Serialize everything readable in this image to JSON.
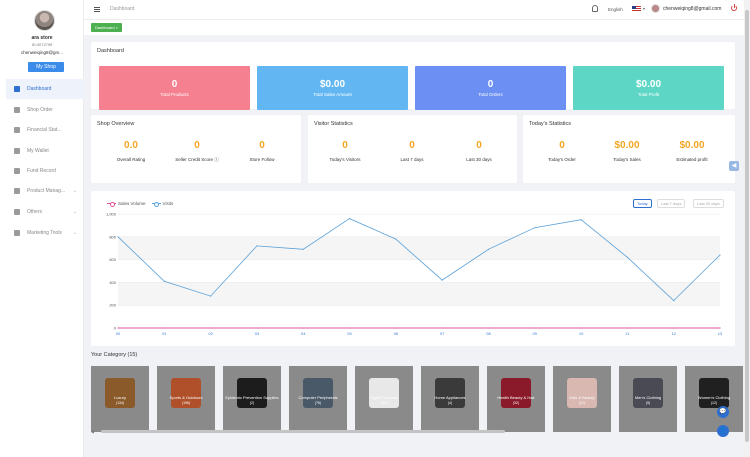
{
  "sidebar": {
    "store_name": "ara store",
    "store_id": "ID:4072795",
    "store_email": "chenweiqing8@gm...",
    "myshop_label": "My Shop",
    "items": [
      {
        "label": "Dashboard",
        "icon": "dashboard-icon",
        "active": true
      },
      {
        "label": "Shop Order",
        "icon": "order-icon",
        "chevron": false
      },
      {
        "label": "Financial Stat...",
        "icon": "finance-icon",
        "chevron": false
      },
      {
        "label": "My Wallet",
        "icon": "wallet-icon",
        "chevron": false
      },
      {
        "label": "Fund Record",
        "icon": "record-icon",
        "chevron": false
      },
      {
        "label": "Product Manag...",
        "icon": "product-icon",
        "chevron": true
      },
      {
        "label": "Others",
        "icon": "grid-icon",
        "chevron": true
      },
      {
        "label": "Marketing Tools",
        "icon": "chart-icon",
        "chevron": true
      }
    ]
  },
  "topbar": {
    "breadcrumb": "Dashboard",
    "language": "English",
    "caret": "▾",
    "user_email": "chenweiqing8@gmail.com"
  },
  "tag": {
    "label": "Dashboard ×"
  },
  "dashboard": {
    "title": "Dashboard",
    "stats": [
      {
        "value": "0",
        "label": "Total Products",
        "color": "#f5808f"
      },
      {
        "value": "$0.00",
        "label": "Total Sales Amount",
        "color": "#62b7f2"
      },
      {
        "value": "0",
        "label": "Total Orders",
        "color": "#6b8ff2"
      },
      {
        "value": "$0.00",
        "label": "Total Profit",
        "color": "#5ed6c6"
      }
    ]
  },
  "shop_overview": {
    "title": "Shop Overview",
    "metrics": [
      {
        "value": "0.0",
        "label": "Overall Rating"
      },
      {
        "value": "0",
        "label": "Seller Credit Score ⓘ"
      },
      {
        "value": "0",
        "label": "Store Follow"
      }
    ]
  },
  "visitor_statistics": {
    "title": "Visitor Statistics",
    "metrics": [
      {
        "value": "0",
        "label": "Today's Visitors"
      },
      {
        "value": "0",
        "label": "Last 7 days"
      },
      {
        "value": "0",
        "label": "Last 30 days"
      }
    ]
  },
  "todays_statistics": {
    "title": "Today's Statistics",
    "metrics": [
      {
        "value": "0",
        "label": "Today's Order"
      },
      {
        "value": "$0.00",
        "label": "Today's Sales"
      },
      {
        "value": "$0.00",
        "label": "Estimated profit"
      }
    ]
  },
  "chart_controls": {
    "legend": [
      {
        "name": "Sales Volume",
        "color": "#e0559a"
      },
      {
        "name": "Visits",
        "color": "#5aa0d8"
      }
    ],
    "ranges": [
      {
        "label": "Today",
        "active": true
      },
      {
        "label": "Last 7 days",
        "active": false
      },
      {
        "label": "Last 30 days",
        "active": false
      }
    ]
  },
  "chart_data": {
    "type": "line",
    "x": [
      "00",
      "01",
      "02",
      "03",
      "04",
      "05",
      "06",
      "07",
      "08",
      "09",
      "10",
      "11",
      "12",
      "13"
    ],
    "series": [
      {
        "name": "Sales Volume",
        "color": "#e0559a",
        "values": [
          0,
          0,
          0,
          0,
          0,
          0,
          0,
          0,
          0,
          0,
          0,
          0,
          0,
          0
        ]
      },
      {
        "name": "Visits",
        "color": "#5aa0d8",
        "values": [
          800,
          410,
          280,
          720,
          690,
          960,
          780,
          420,
          690,
          880,
          950,
          620,
          240,
          640
        ]
      }
    ],
    "ylim": [
      0,
      1000
    ],
    "yticks": [
      "0",
      "200",
      "400",
      "600",
      "800",
      "1,000"
    ],
    "grid": true
  },
  "categories": {
    "title": "Your Category  (15)",
    "items": [
      {
        "name": "Luxury",
        "count": "(134)",
        "color": "#8b5a2b"
      },
      {
        "name": "Sports & Outdoors",
        "count": "(196)",
        "color": "#b0502a"
      },
      {
        "name": "Epidemic Prevention Supplies",
        "count": "(2)",
        "color": "#1c1c1c"
      },
      {
        "name": "Computer Peripherals",
        "count": "(76)",
        "color": "#4a5968"
      },
      {
        "name": "Digital Products",
        "count": "(97)",
        "color": "#e8e8e8"
      },
      {
        "name": "Home Appliances",
        "count": "(4)",
        "color": "#3a3a3a"
      },
      {
        "name": "Health Beauty & Hair",
        "count": "(32)",
        "color": "#8a1a2a"
      },
      {
        "name": "Kids & Beauty",
        "count": "(22)",
        "color": "#d8b8b0"
      },
      {
        "name": "Men's Clothing",
        "count": "(9)",
        "color": "#4a4a54"
      },
      {
        "name": "Women's Clothing",
        "count": "(12)",
        "color": "#202020"
      }
    ]
  },
  "floating": {
    "chat_icon": "💬",
    "user_icon": "👤",
    "side_tab": "◀"
  }
}
